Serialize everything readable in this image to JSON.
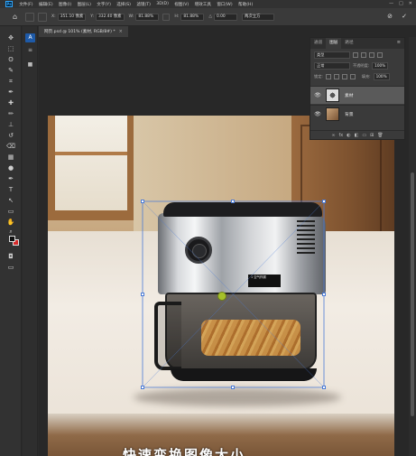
{
  "menubar": {
    "logo": "Ps",
    "items": [
      "文件(F)",
      "编辑(E)",
      "图像(I)",
      "图层(L)",
      "文字(Y)",
      "选择(S)",
      "滤镜(T)",
      "3D(D)",
      "视图(V)",
      "增效工具",
      "窗口(W)",
      "帮助(H)"
    ],
    "controls": [
      "—",
      "□",
      "✕"
    ]
  },
  "options": {
    "x_label": "X:",
    "x_value": "351.10 像素",
    "y_label": "Y:",
    "y_value": "332.40 像素",
    "w_label": "W:",
    "w_value": "81.88%",
    "h_label": "H:",
    "h_value": "81.88%",
    "angle_label": "△",
    "angle_value": "0.00",
    "interp_value": "两次立方",
    "commit": "✓",
    "cancel": "⊘"
  },
  "tools": {
    "icons": [
      "move-icon",
      "marquee-icon",
      "lasso-icon",
      "quick-select-icon",
      "crop-icon",
      "eyedropper-icon",
      "healing-icon",
      "brush-icon",
      "stamp-icon",
      "history-brush-icon",
      "eraser-icon",
      "gradient-icon",
      "dodge-icon",
      "pen-icon",
      "type-icon",
      "path-select-icon",
      "shape-icon",
      "hand-icon",
      "zoom-icon",
      "more-icon"
    ],
    "glyphs": [
      "✥",
      "⬚",
      "ʘ",
      "✎",
      "⌗",
      "✒",
      "✚",
      "✏",
      "⊥",
      "↺",
      "⌫",
      "▦",
      "●",
      "✒",
      "T",
      "↖",
      "▭",
      "✋",
      "⌕",
      "⋯"
    ]
  },
  "document": {
    "tab_title": "网页.psd @ 101% (素材, RGB/8#) *",
    "tab_close": "×"
  },
  "layers_panel": {
    "tabs": [
      "图层",
      "通道",
      "路径"
    ],
    "kind_label": "类型",
    "blend_mode": "正常",
    "opacity_label": "不透明度:",
    "opacity_value": "100%",
    "lock_label": "锁定:",
    "fill_label": "填充:",
    "fill_value": "100%",
    "layers": [
      {
        "name": "素材",
        "visible": true,
        "selected": true
      },
      {
        "name": "背景",
        "visible": true,
        "selected": false
      }
    ],
    "footer_icons": [
      "∞",
      "fx",
      "◐",
      "◧",
      "▭",
      "⊞",
      "🗑"
    ]
  },
  "product_label": "1 空气炸锅",
  "subtitle": "快速变换图像大小"
}
